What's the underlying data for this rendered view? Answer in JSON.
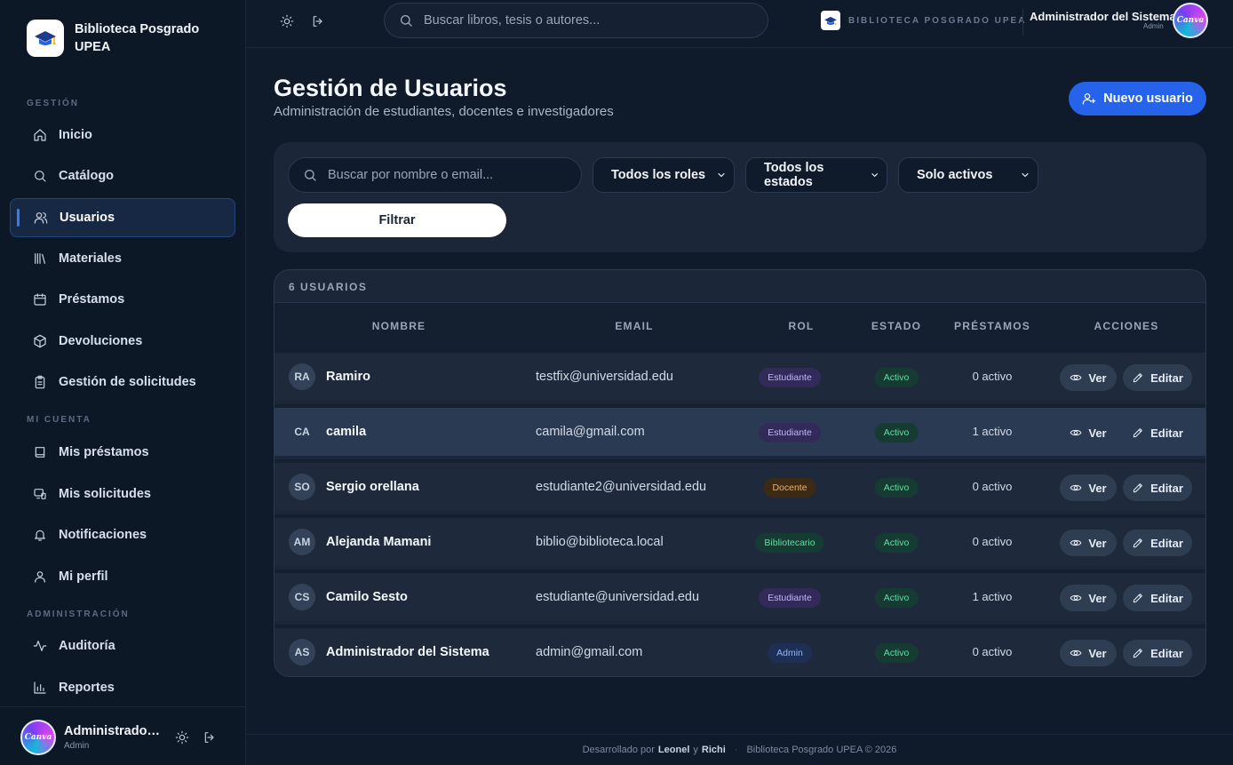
{
  "brand": {
    "name": "Biblioteca Posgrado UPEA",
    "top_label": "BIBLIOTECA POSGRADO UPEA"
  },
  "sidebar": {
    "sections": {
      "gestion": "GESTIÓN",
      "mi_cuenta": "MI CUENTA",
      "administracion": "ADMINISTRACIÓN"
    },
    "items": [
      {
        "label": "Inicio",
        "icon": "home-icon"
      },
      {
        "label": "Catálogo",
        "icon": "search-icon"
      },
      {
        "label": "Usuarios",
        "icon": "users-icon",
        "active": true
      },
      {
        "label": "Materiales",
        "icon": "library-icon"
      },
      {
        "label": "Préstamos",
        "icon": "calendar-icon"
      },
      {
        "label": "Devoluciones",
        "icon": "package-icon"
      },
      {
        "label": "Gestión de solicitudes",
        "icon": "clipboard-icon"
      },
      {
        "label": "Mis préstamos",
        "icon": "book-icon"
      },
      {
        "label": "Mis solicitudes",
        "icon": "request-icon"
      },
      {
        "label": "Notificaciones",
        "icon": "bell-icon"
      },
      {
        "label": "Mi perfil",
        "icon": "user-icon"
      },
      {
        "label": "Auditoría",
        "icon": "activity-icon"
      },
      {
        "label": "Reportes",
        "icon": "chart-icon"
      }
    ],
    "footer": {
      "name": "Administrador ...",
      "role": "Admin"
    }
  },
  "topbar": {
    "search_placeholder": "Buscar libros, tesis o autores...",
    "user_name": "Administrador del Sistema",
    "user_role": "Admin",
    "avatar_text": "Canva"
  },
  "page": {
    "title": "Gestión de Usuarios",
    "subtitle": "Administración de estudiantes, docentes e investigadores",
    "new_button": "Nuevo usuario"
  },
  "filters": {
    "search_placeholder": "Buscar por nombre o email...",
    "role": "Todos los roles",
    "status": "Todos los estados",
    "active": "Solo activos",
    "button": "Filtrar"
  },
  "table": {
    "count": "6 USUARIOS",
    "headers": {
      "name": "NOMBRE",
      "email": "EMAIL",
      "role": "ROL",
      "status": "ESTADO",
      "loans": "PRÉSTAMOS",
      "actions": "ACCIONES"
    },
    "view_label": "Ver",
    "edit_label": "Editar",
    "rows": [
      {
        "initials": "RA",
        "name": "Ramiro",
        "email": "testfix@universidad.edu",
        "role": "Estudiante",
        "status": "Activo",
        "loans": "0 activo"
      },
      {
        "initials": "CA",
        "name": "camila",
        "email": "camila@gmail.com",
        "role": "Estudiante",
        "status": "Activo",
        "loans": "1 activo"
      },
      {
        "initials": "SO",
        "name": "Sergio orellana",
        "email": "estudiante2@universidad.edu",
        "role": "Docente",
        "status": "Activo",
        "loans": "0 activo"
      },
      {
        "initials": "AM",
        "name": "Alejanda Mamani",
        "email": "biblio@biblioteca.local",
        "role": "Bibliotecario",
        "status": "Activo",
        "loans": "0 activo"
      },
      {
        "initials": "CS",
        "name": "Camilo Sesto",
        "email": "estudiante@universidad.edu",
        "role": "Estudiante",
        "status": "Activo",
        "loans": "1 activo"
      },
      {
        "initials": "AS",
        "name": "Administrador del Sistema",
        "email": "admin@gmail.com",
        "role": "Admin",
        "status": "Activo",
        "loans": "0 activo"
      }
    ]
  },
  "footer": {
    "prefix": "Desarrollado por",
    "author1": "Leonel",
    "and": "y",
    "author2": "Richi",
    "sep": "·",
    "copyright": "Biblioteca Posgrado UPEA © 2026"
  },
  "colors": {
    "accent": "#2563eb",
    "role_estudiante": "#a78bfa",
    "role_docente": "#f59e0b",
    "role_bibliotecario": "#34d399",
    "role_admin": "#60a5fa",
    "status_active": "#5fe0a0"
  }
}
